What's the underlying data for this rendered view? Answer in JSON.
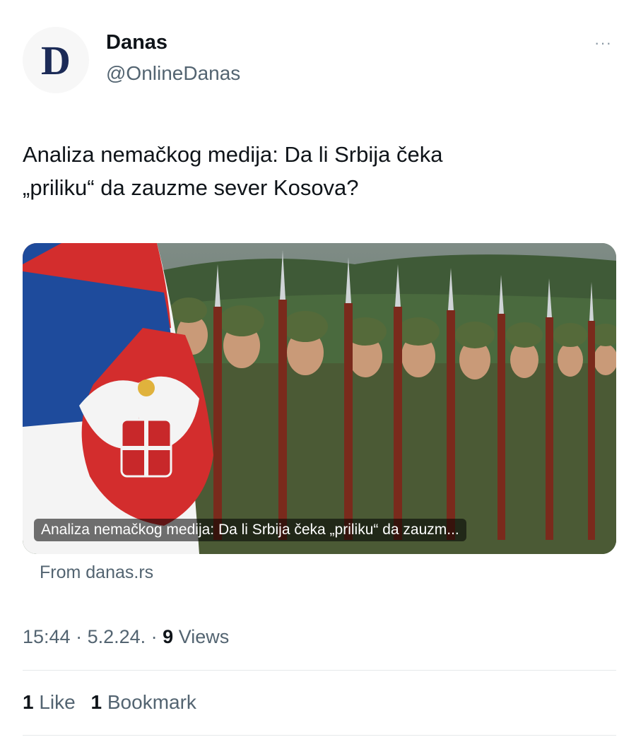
{
  "author": {
    "avatar_letter": "D",
    "name": "Danas",
    "handle": "@OnlineDanas"
  },
  "more_icon": "···",
  "tweet": {
    "line1": "Analiza nemačkog medija: Da li Srbija čeka",
    "line2": "„priliku“ da zauzme sever Kosova?"
  },
  "card": {
    "caption": "Analiza nemačkog medija: Da li Srbija čeka „priliku“ da zauzm...",
    "source": "From danas.rs"
  },
  "meta": {
    "time": "15:44",
    "sep": " · ",
    "date": "5.2.24.",
    "views_count": "9",
    "views_label": "Views"
  },
  "stats": {
    "likes_count": "1",
    "likes_label": "Like",
    "bookmarks_count": "1",
    "bookmarks_label": "Bookmark"
  },
  "colors": {
    "text_primary": "#0f1419",
    "text_secondary": "#536471",
    "logo": "#1c2b57"
  }
}
